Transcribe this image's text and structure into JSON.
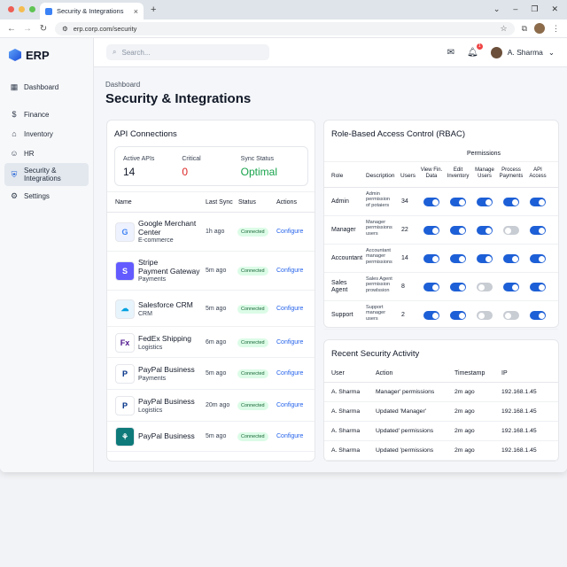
{
  "browser": {
    "tab_title": "Security & Integrations",
    "url": "erp.corp.com/security",
    "traffic_colors": [
      "#ee5e55",
      "#f5bd4f",
      "#5fc454"
    ]
  },
  "app": {
    "brand": "ERP",
    "accent": "#1d5fd6",
    "search_placeholder": "Search...",
    "notification_count": "1",
    "user_name": "A. Sharma"
  },
  "sidebar": {
    "items": [
      {
        "label": "Dashboard"
      },
      {
        "label": "Finance"
      },
      {
        "label": "Inventory"
      },
      {
        "label": "HR"
      },
      {
        "label": "Security &\nIntegrations"
      },
      {
        "label": "Settings"
      }
    ]
  },
  "page": {
    "breadcrumb": "Dashboard",
    "title": "Security & Integrations"
  },
  "api": {
    "title": "API Connections",
    "stats": [
      {
        "label": "Active APIs",
        "value": "14"
      },
      {
        "label": "Critical",
        "value": "0"
      },
      {
        "label": "Sync Status",
        "value": "Optimal"
      }
    ],
    "columns": [
      "Name",
      "Last Sync",
      "Status",
      "Actions"
    ],
    "rows": [
      {
        "name": "Google Merchant\nCenter",
        "category": "E-commerce",
        "sync": "1h ago",
        "status": "Connected",
        "action": "Configure"
      },
      {
        "name": "Stripe\nPayment Gateway",
        "category": "Payments",
        "sync": "5m ago",
        "status": "Connected",
        "action": "Configure"
      },
      {
        "name": "Salesforce CRM",
        "category": "CRM",
        "sync": "5m ago",
        "status": "Connected",
        "action": "Configure"
      },
      {
        "name": "FedEx Shipping",
        "category": "Logistics",
        "sync": "6m ago",
        "status": "Connected",
        "action": "Configure"
      },
      {
        "name": "PayPal Business",
        "category": "Payments",
        "sync": "5m ago",
        "status": "Connected",
        "action": "Configure"
      },
      {
        "name": "PayPal Business",
        "category": "Logistics",
        "sync": "20m ago",
        "status": "Connected",
        "action": "Configure"
      },
      {
        "name": "PayPal Business",
        "category": "",
        "sync": "5m ago",
        "status": "Connected",
        "action": "Configure"
      }
    ]
  },
  "rbac": {
    "title": "Role-Based Access Control (RBAC)",
    "permissions_label": "Permissions",
    "columns": [
      "Role",
      "Description",
      "Users",
      "View Fin.\nData",
      "Edit\nInventory",
      "Manage\nUsers",
      "Process\nPayments",
      "API\nAccess"
    ],
    "rows": [
      {
        "role": "Admin",
        "desc": "Admin\npermission\nof potaiers",
        "users": "34",
        "perms": [
          true,
          true,
          true,
          true,
          true
        ]
      },
      {
        "role": "Manager",
        "desc": "Manager\npermissions\nusers",
        "users": "22",
        "perms": [
          true,
          true,
          true,
          false,
          true
        ]
      },
      {
        "role": "Accountant",
        "desc": "Accountant\nmanager\npermissions",
        "users": "14",
        "perms": [
          true,
          true,
          true,
          true,
          true
        ]
      },
      {
        "role": "Sales\nAgent",
        "desc": "Sales Agent\npermission\nprowlssion",
        "users": "8",
        "perms": [
          true,
          true,
          false,
          true,
          true
        ]
      },
      {
        "role": "Support",
        "desc": "Support\nmanager\nusers",
        "users": "2",
        "perms": [
          true,
          true,
          false,
          false,
          true
        ]
      }
    ]
  },
  "activity": {
    "title": "Recent Security Activity",
    "columns": [
      "User",
      "Action",
      "Timestamp",
      "IP"
    ],
    "rows": [
      {
        "user": "A. Sharma",
        "action": "Manager' permissions",
        "time": "2m ago",
        "ip": "192.168.1.45"
      },
      {
        "user": "A. Sharma",
        "action": "Updated 'Manager'",
        "time": "2m ago",
        "ip": "192.168.1.45"
      },
      {
        "user": "A. Sharma",
        "action": "Updated' permissions",
        "time": "2m ago",
        "ip": "192.168.1.45"
      },
      {
        "user": "A. Sharma",
        "action": "Updated 'permissions",
        "time": "2m ago",
        "ip": "192.168.1.45"
      }
    ]
  }
}
